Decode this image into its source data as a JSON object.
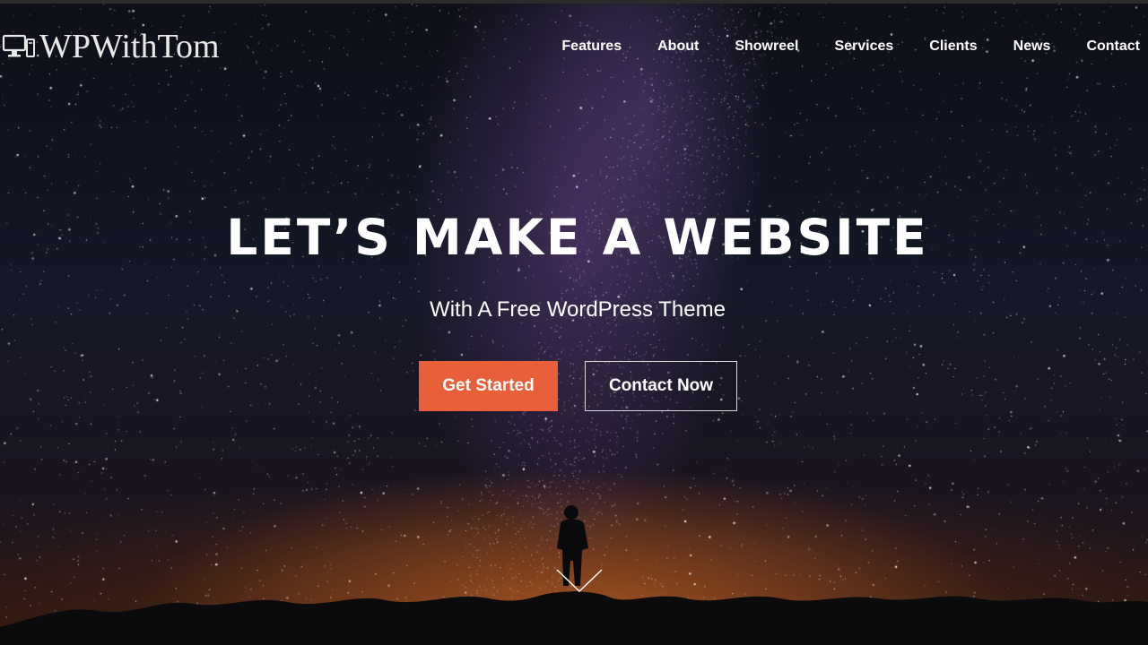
{
  "site": {
    "logo_text": "WPWithTom",
    "logo_icon": "desktop-monitor-icon"
  },
  "nav": {
    "items": [
      {
        "label": "Features"
      },
      {
        "label": "About"
      },
      {
        "label": "Showreel"
      },
      {
        "label": "Services"
      },
      {
        "label": "Clients"
      },
      {
        "label": "News"
      },
      {
        "label": "Contact"
      }
    ]
  },
  "hero": {
    "headline": "LET’S MAKE A WEBSITE",
    "subheadline": "With A Free WordPress Theme",
    "primary_button": "Get Started",
    "secondary_button": "Contact Now",
    "scroll_icon": "chevron-down-icon"
  },
  "colors": {
    "accent": "#e85f3a",
    "text": "#ffffff",
    "background": "#0d1018"
  }
}
